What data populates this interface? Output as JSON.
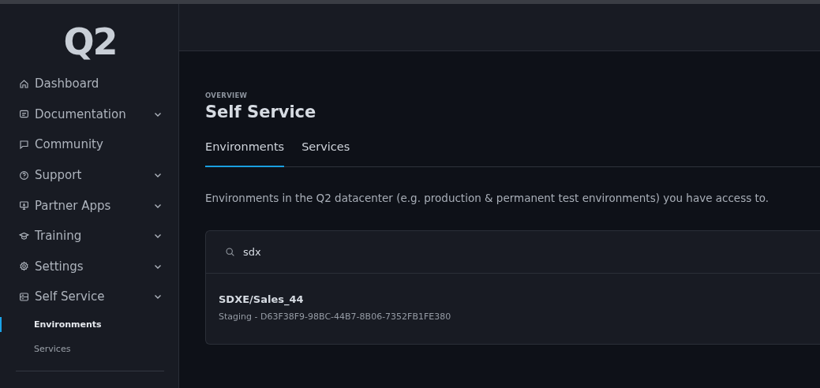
{
  "logo": "Q2",
  "sidebar": {
    "items": [
      {
        "label": "Dashboard",
        "kind": "home",
        "has_submenu": false
      },
      {
        "label": "Documentation",
        "kind": "doc",
        "has_submenu": true
      },
      {
        "label": "Community",
        "kind": "chat",
        "has_submenu": false
      },
      {
        "label": "Support",
        "kind": "help",
        "has_submenu": true
      },
      {
        "label": "Partner Apps",
        "kind": "monitor",
        "has_submenu": true
      },
      {
        "label": "Training",
        "kind": "cap",
        "has_submenu": true
      },
      {
        "label": "Settings",
        "kind": "gear",
        "has_submenu": true
      },
      {
        "label": "Self Service",
        "kind": "server",
        "has_submenu": true,
        "children": [
          {
            "label": "Environments",
            "selected": true
          },
          {
            "label": "Services",
            "selected": false
          }
        ]
      }
    ]
  },
  "page": {
    "eyebrow": "OVERVIEW",
    "title": "Self Service",
    "tabs": [
      {
        "label": "Environments",
        "selected": true
      },
      {
        "label": "Services",
        "selected": false
      }
    ],
    "description": "Environments in the Q2 datacenter (e.g. production & permanent test environments) you have access to.",
    "search": {
      "value": "sdx"
    },
    "results": [
      {
        "name": "SDXE/Sales_44",
        "detail": "Staging - D63F38F9-98BC-44B7-8B06-7352FB1FE380"
      }
    ]
  }
}
